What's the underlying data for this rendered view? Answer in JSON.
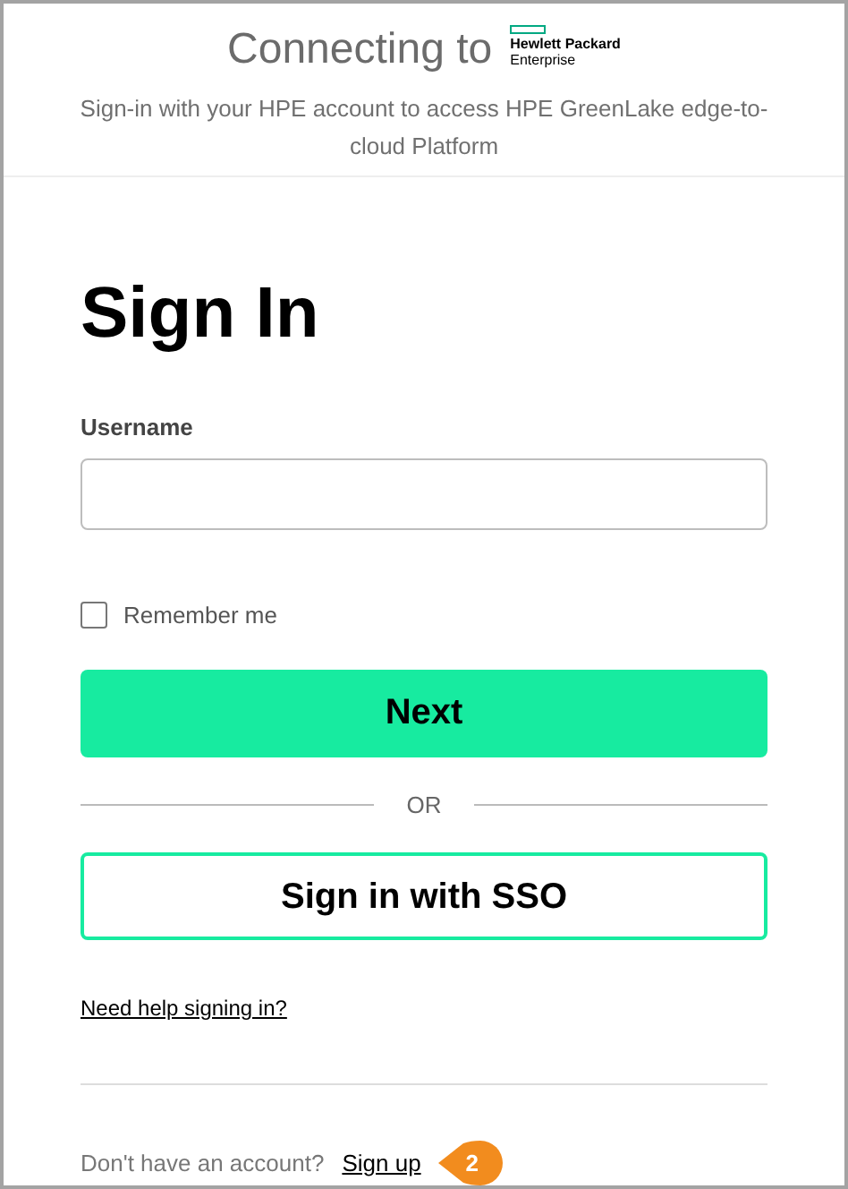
{
  "header": {
    "title": "Connecting to",
    "logo_line_1": "Hewlett Packard",
    "logo_line_2": "Enterprise",
    "subtitle": "Sign-in with your HPE account to access HPE GreenLake edge-to-cloud Platform"
  },
  "heading": "Sign In",
  "username": {
    "label": "Username"
  },
  "remember": {
    "label": "Remember me",
    "checked": false
  },
  "next_button": "Next",
  "divider_text": "OR",
  "sso_button": "Sign in with SSO",
  "help_link": "Need help signing in?",
  "signup": {
    "prompt": "Don't have an account?",
    "link": "Sign up"
  },
  "callout": "2"
}
